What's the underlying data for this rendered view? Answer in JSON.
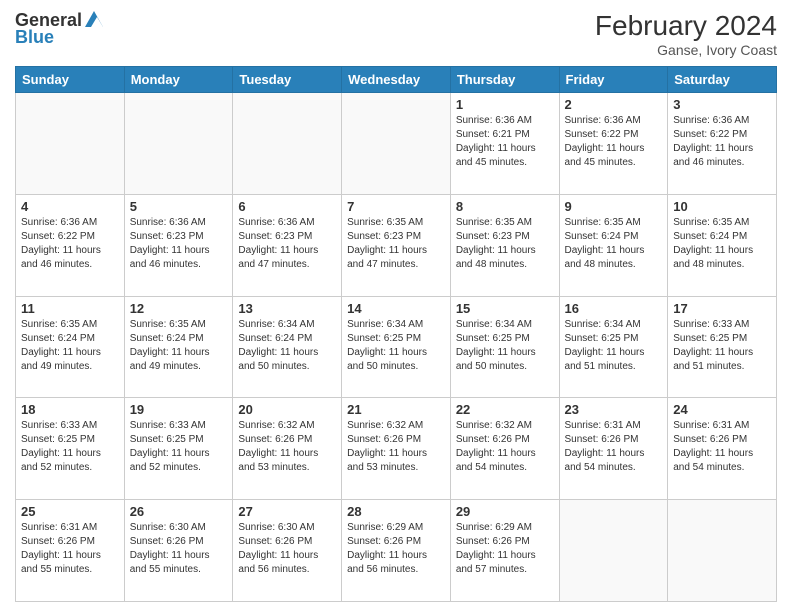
{
  "header": {
    "logo_general": "General",
    "logo_blue": "Blue",
    "month_year": "February 2024",
    "location": "Ganse, Ivory Coast"
  },
  "days_of_week": [
    "Sunday",
    "Monday",
    "Tuesday",
    "Wednesday",
    "Thursday",
    "Friday",
    "Saturday"
  ],
  "weeks": [
    [
      {
        "day": "",
        "info": ""
      },
      {
        "day": "",
        "info": ""
      },
      {
        "day": "",
        "info": ""
      },
      {
        "day": "",
        "info": ""
      },
      {
        "day": "1",
        "info": "Sunrise: 6:36 AM\nSunset: 6:21 PM\nDaylight: 11 hours and 45 minutes."
      },
      {
        "day": "2",
        "info": "Sunrise: 6:36 AM\nSunset: 6:22 PM\nDaylight: 11 hours and 45 minutes."
      },
      {
        "day": "3",
        "info": "Sunrise: 6:36 AM\nSunset: 6:22 PM\nDaylight: 11 hours and 46 minutes."
      }
    ],
    [
      {
        "day": "4",
        "info": "Sunrise: 6:36 AM\nSunset: 6:22 PM\nDaylight: 11 hours and 46 minutes."
      },
      {
        "day": "5",
        "info": "Sunrise: 6:36 AM\nSunset: 6:23 PM\nDaylight: 11 hours and 46 minutes."
      },
      {
        "day": "6",
        "info": "Sunrise: 6:36 AM\nSunset: 6:23 PM\nDaylight: 11 hours and 47 minutes."
      },
      {
        "day": "7",
        "info": "Sunrise: 6:35 AM\nSunset: 6:23 PM\nDaylight: 11 hours and 47 minutes."
      },
      {
        "day": "8",
        "info": "Sunrise: 6:35 AM\nSunset: 6:23 PM\nDaylight: 11 hours and 48 minutes."
      },
      {
        "day": "9",
        "info": "Sunrise: 6:35 AM\nSunset: 6:24 PM\nDaylight: 11 hours and 48 minutes."
      },
      {
        "day": "10",
        "info": "Sunrise: 6:35 AM\nSunset: 6:24 PM\nDaylight: 11 hours and 48 minutes."
      }
    ],
    [
      {
        "day": "11",
        "info": "Sunrise: 6:35 AM\nSunset: 6:24 PM\nDaylight: 11 hours and 49 minutes."
      },
      {
        "day": "12",
        "info": "Sunrise: 6:35 AM\nSunset: 6:24 PM\nDaylight: 11 hours and 49 minutes."
      },
      {
        "day": "13",
        "info": "Sunrise: 6:34 AM\nSunset: 6:24 PM\nDaylight: 11 hours and 50 minutes."
      },
      {
        "day": "14",
        "info": "Sunrise: 6:34 AM\nSunset: 6:25 PM\nDaylight: 11 hours and 50 minutes."
      },
      {
        "day": "15",
        "info": "Sunrise: 6:34 AM\nSunset: 6:25 PM\nDaylight: 11 hours and 50 minutes."
      },
      {
        "day": "16",
        "info": "Sunrise: 6:34 AM\nSunset: 6:25 PM\nDaylight: 11 hours and 51 minutes."
      },
      {
        "day": "17",
        "info": "Sunrise: 6:33 AM\nSunset: 6:25 PM\nDaylight: 11 hours and 51 minutes."
      }
    ],
    [
      {
        "day": "18",
        "info": "Sunrise: 6:33 AM\nSunset: 6:25 PM\nDaylight: 11 hours and 52 minutes."
      },
      {
        "day": "19",
        "info": "Sunrise: 6:33 AM\nSunset: 6:25 PM\nDaylight: 11 hours and 52 minutes."
      },
      {
        "day": "20",
        "info": "Sunrise: 6:32 AM\nSunset: 6:26 PM\nDaylight: 11 hours and 53 minutes."
      },
      {
        "day": "21",
        "info": "Sunrise: 6:32 AM\nSunset: 6:26 PM\nDaylight: 11 hours and 53 minutes."
      },
      {
        "day": "22",
        "info": "Sunrise: 6:32 AM\nSunset: 6:26 PM\nDaylight: 11 hours and 54 minutes."
      },
      {
        "day": "23",
        "info": "Sunrise: 6:31 AM\nSunset: 6:26 PM\nDaylight: 11 hours and 54 minutes."
      },
      {
        "day": "24",
        "info": "Sunrise: 6:31 AM\nSunset: 6:26 PM\nDaylight: 11 hours and 54 minutes."
      }
    ],
    [
      {
        "day": "25",
        "info": "Sunrise: 6:31 AM\nSunset: 6:26 PM\nDaylight: 11 hours and 55 minutes."
      },
      {
        "day": "26",
        "info": "Sunrise: 6:30 AM\nSunset: 6:26 PM\nDaylight: 11 hours and 55 minutes."
      },
      {
        "day": "27",
        "info": "Sunrise: 6:30 AM\nSunset: 6:26 PM\nDaylight: 11 hours and 56 minutes."
      },
      {
        "day": "28",
        "info": "Sunrise: 6:29 AM\nSunset: 6:26 PM\nDaylight: 11 hours and 56 minutes."
      },
      {
        "day": "29",
        "info": "Sunrise: 6:29 AM\nSunset: 6:26 PM\nDaylight: 11 hours and 57 minutes."
      },
      {
        "day": "",
        "info": ""
      },
      {
        "day": "",
        "info": ""
      }
    ]
  ]
}
